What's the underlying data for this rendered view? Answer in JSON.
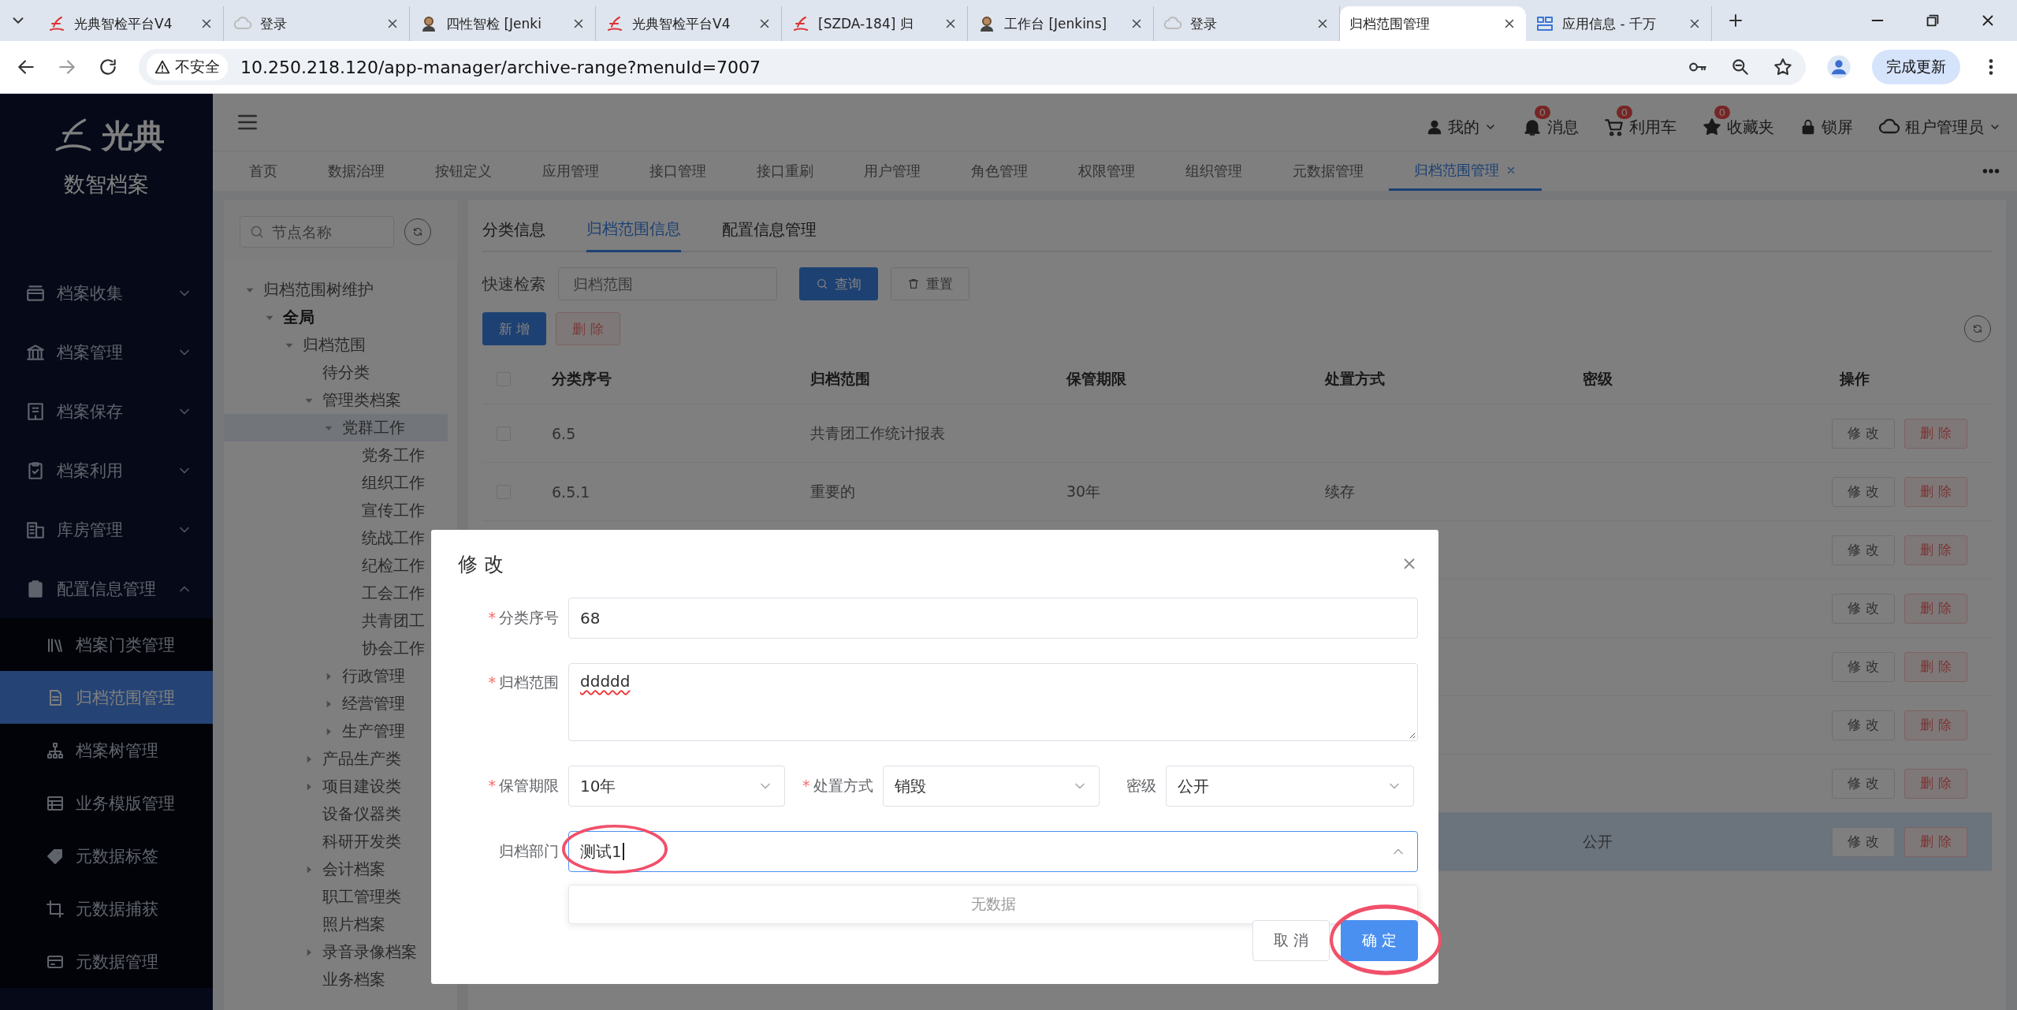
{
  "browser": {
    "tabs": [
      {
        "title": "光典智检平台V4",
        "selected": false
      },
      {
        "title": "登录",
        "selected": false
      },
      {
        "title": "四性智检 [Jenki",
        "selected": false
      },
      {
        "title": "光典智检平台V4",
        "selected": false
      },
      {
        "title": "[SZDA-184] 归",
        "selected": false
      },
      {
        "title": "工作台 [Jenkins]",
        "selected": false
      },
      {
        "title": "登录",
        "selected": false
      },
      {
        "title": "归档范围管理",
        "selected": true
      },
      {
        "title": "应用信息 - 千万",
        "selected": false
      }
    ],
    "security_label": "不安全",
    "url": "10.250.218.120/app-manager/archive-range?menuId=7007",
    "update_button": "完成更新"
  },
  "app": {
    "logo_text": "光典",
    "product_name": "数智档案"
  },
  "sidebar": {
    "items": [
      {
        "label": "档案收集",
        "expanded": false
      },
      {
        "label": "档案管理",
        "expanded": false
      },
      {
        "label": "档案保存",
        "expanded": false
      },
      {
        "label": "档案利用",
        "expanded": false
      },
      {
        "label": "库房管理",
        "expanded": false
      },
      {
        "label": "配置信息管理",
        "expanded": true,
        "children": [
          {
            "label": "档案门类管理",
            "selected": false
          },
          {
            "label": "归档范围管理",
            "selected": true
          },
          {
            "label": "档案树管理",
            "selected": false
          },
          {
            "label": "业务模版管理",
            "selected": false
          },
          {
            "label": "元数据标签",
            "selected": false
          },
          {
            "label": "元数据捕获",
            "selected": false
          },
          {
            "label": "元数据管理",
            "selected": false
          }
        ]
      }
    ]
  },
  "header": {
    "user_menu": "我的",
    "actions": [
      {
        "label": "消息",
        "badge": "0"
      },
      {
        "label": "利用车",
        "badge": "0"
      },
      {
        "label": "收藏夹",
        "badge": "0"
      }
    ],
    "lock": "锁屏",
    "tenant": "租户管理员"
  },
  "nav_tabs": [
    {
      "label": "首页",
      "selected": false
    },
    {
      "label": "数据治理",
      "selected": false
    },
    {
      "label": "按钮定义",
      "selected": false
    },
    {
      "label": "应用管理",
      "selected": false
    },
    {
      "label": "接口管理",
      "selected": false
    },
    {
      "label": "接口重刷",
      "selected": false
    },
    {
      "label": "用户管理",
      "selected": false
    },
    {
      "label": "角色管理",
      "selected": false
    },
    {
      "label": "权限管理",
      "selected": false
    },
    {
      "label": "组织管理",
      "selected": false
    },
    {
      "label": "元数据管理",
      "selected": false
    },
    {
      "label": "归档范围管理",
      "selected": true
    }
  ],
  "tree": {
    "search_placeholder": "节点名称",
    "nodes": [
      {
        "label": "归档范围树维护",
        "expanded": true,
        "selected": false,
        "children": [
          {
            "label": "全局",
            "bold": true,
            "expanded": true,
            "selected": false,
            "children": [
              {
                "label": "归档范围",
                "expanded": true,
                "selected": false,
                "children": [
                  {
                    "label": "待分类",
                    "selected": false
                  },
                  {
                    "label": "管理类档案",
                    "expanded": true,
                    "selected": false,
                    "children": [
                      {
                        "label": "党群工作",
                        "expanded": true,
                        "selected": true,
                        "children": [
                          {
                            "label": "党务工作",
                            "selected": false
                          },
                          {
                            "label": "组织工作",
                            "selected": false
                          },
                          {
                            "label": "宣传工作",
                            "selected": false
                          },
                          {
                            "label": "统战工作",
                            "selected": false
                          },
                          {
                            "label": "纪检工作",
                            "selected": false
                          },
                          {
                            "label": "工会工作",
                            "selected": false
                          },
                          {
                            "label": "共青团工",
                            "selected": false
                          },
                          {
                            "label": "协会工作",
                            "selected": false
                          }
                        ]
                      },
                      {
                        "label": "行政管理",
                        "expanded": false,
                        "selected": false
                      },
                      {
                        "label": "经营管理",
                        "expanded": false,
                        "selected": false
                      },
                      {
                        "label": "生产管理",
                        "expanded": false,
                        "selected": false
                      }
                    ]
                  },
                  {
                    "label": "产品生产类",
                    "expanded": false,
                    "selected": false
                  },
                  {
                    "label": "项目建设类",
                    "expanded": false,
                    "selected": false
                  },
                  {
                    "label": "设备仪器类",
                    "selected": false
                  },
                  {
                    "label": "科研开发类",
                    "selected": false
                  },
                  {
                    "label": "会计档案",
                    "expanded": false,
                    "selected": false
                  },
                  {
                    "label": "职工管理类",
                    "selected": false
                  },
                  {
                    "label": "照片档案",
                    "selected": false
                  },
                  {
                    "label": "录音录像档案",
                    "expanded": false,
                    "selected": false
                  },
                  {
                    "label": "业务档案",
                    "selected": false
                  }
                ]
              }
            ]
          }
        ]
      }
    ]
  },
  "content": {
    "tabs": [
      {
        "label": "分类信息",
        "selected": false
      },
      {
        "label": "归档范围信息",
        "selected": true
      },
      {
        "label": "配置信息管理",
        "selected": false
      }
    ],
    "search_label": "快速检索",
    "search_placeholder": "归档范围",
    "query_button": "查询",
    "reset_button": "重置",
    "add_button": "新 增",
    "delete_button": "删 除"
  },
  "table": {
    "header_checked": false,
    "columns": [
      "分类序号",
      "归档范围",
      "保管期限",
      "处置方式",
      "密级",
      "操作"
    ],
    "rows": [
      {
        "checked": false,
        "selected": false,
        "code": "6.5",
        "range": "共青团工作统计报表",
        "edit": "修 改",
        "delete": "删 除"
      },
      {
        "checked": false,
        "selected": false,
        "code": "6.5.1",
        "range": "重要的",
        "period": "30年",
        "disposal": "续存",
        "edit": "修 改",
        "delete": "删 除"
      },
      {
        "selected": false,
        "edit": "修 改",
        "delete": "删 除"
      },
      {
        "selected": false,
        "edit": "修 改",
        "delete": "删 除"
      },
      {
        "selected": false,
        "edit": "修 改",
        "delete": "删 除"
      },
      {
        "selected": false,
        "edit": "修 改",
        "delete": "删 除"
      },
      {
        "selected": false,
        "edit": "修 改",
        "delete": "删 除"
      },
      {
        "selected": true,
        "secret": "公开",
        "edit": "修 改",
        "delete": "删 除"
      }
    ]
  },
  "dialog": {
    "title": "修 改",
    "required_mark": "*",
    "code": {
      "label": "分类序号",
      "required": true,
      "value": "68"
    },
    "range": {
      "label": "归档范围",
      "required": true,
      "value": "ddddd"
    },
    "period": {
      "label": "保管期限",
      "required": true,
      "value": "10年"
    },
    "disposal": {
      "label": "处置方式",
      "required": true,
      "value": "销毁"
    },
    "secret": {
      "label": "密级",
      "required": false,
      "value": "公开"
    },
    "department": {
      "label": "归档部门",
      "required": false,
      "value": "测试1",
      "expanded": true,
      "empty_text": "无数据"
    },
    "cancel_button": "取 消",
    "ok_button": "确 定"
  }
}
